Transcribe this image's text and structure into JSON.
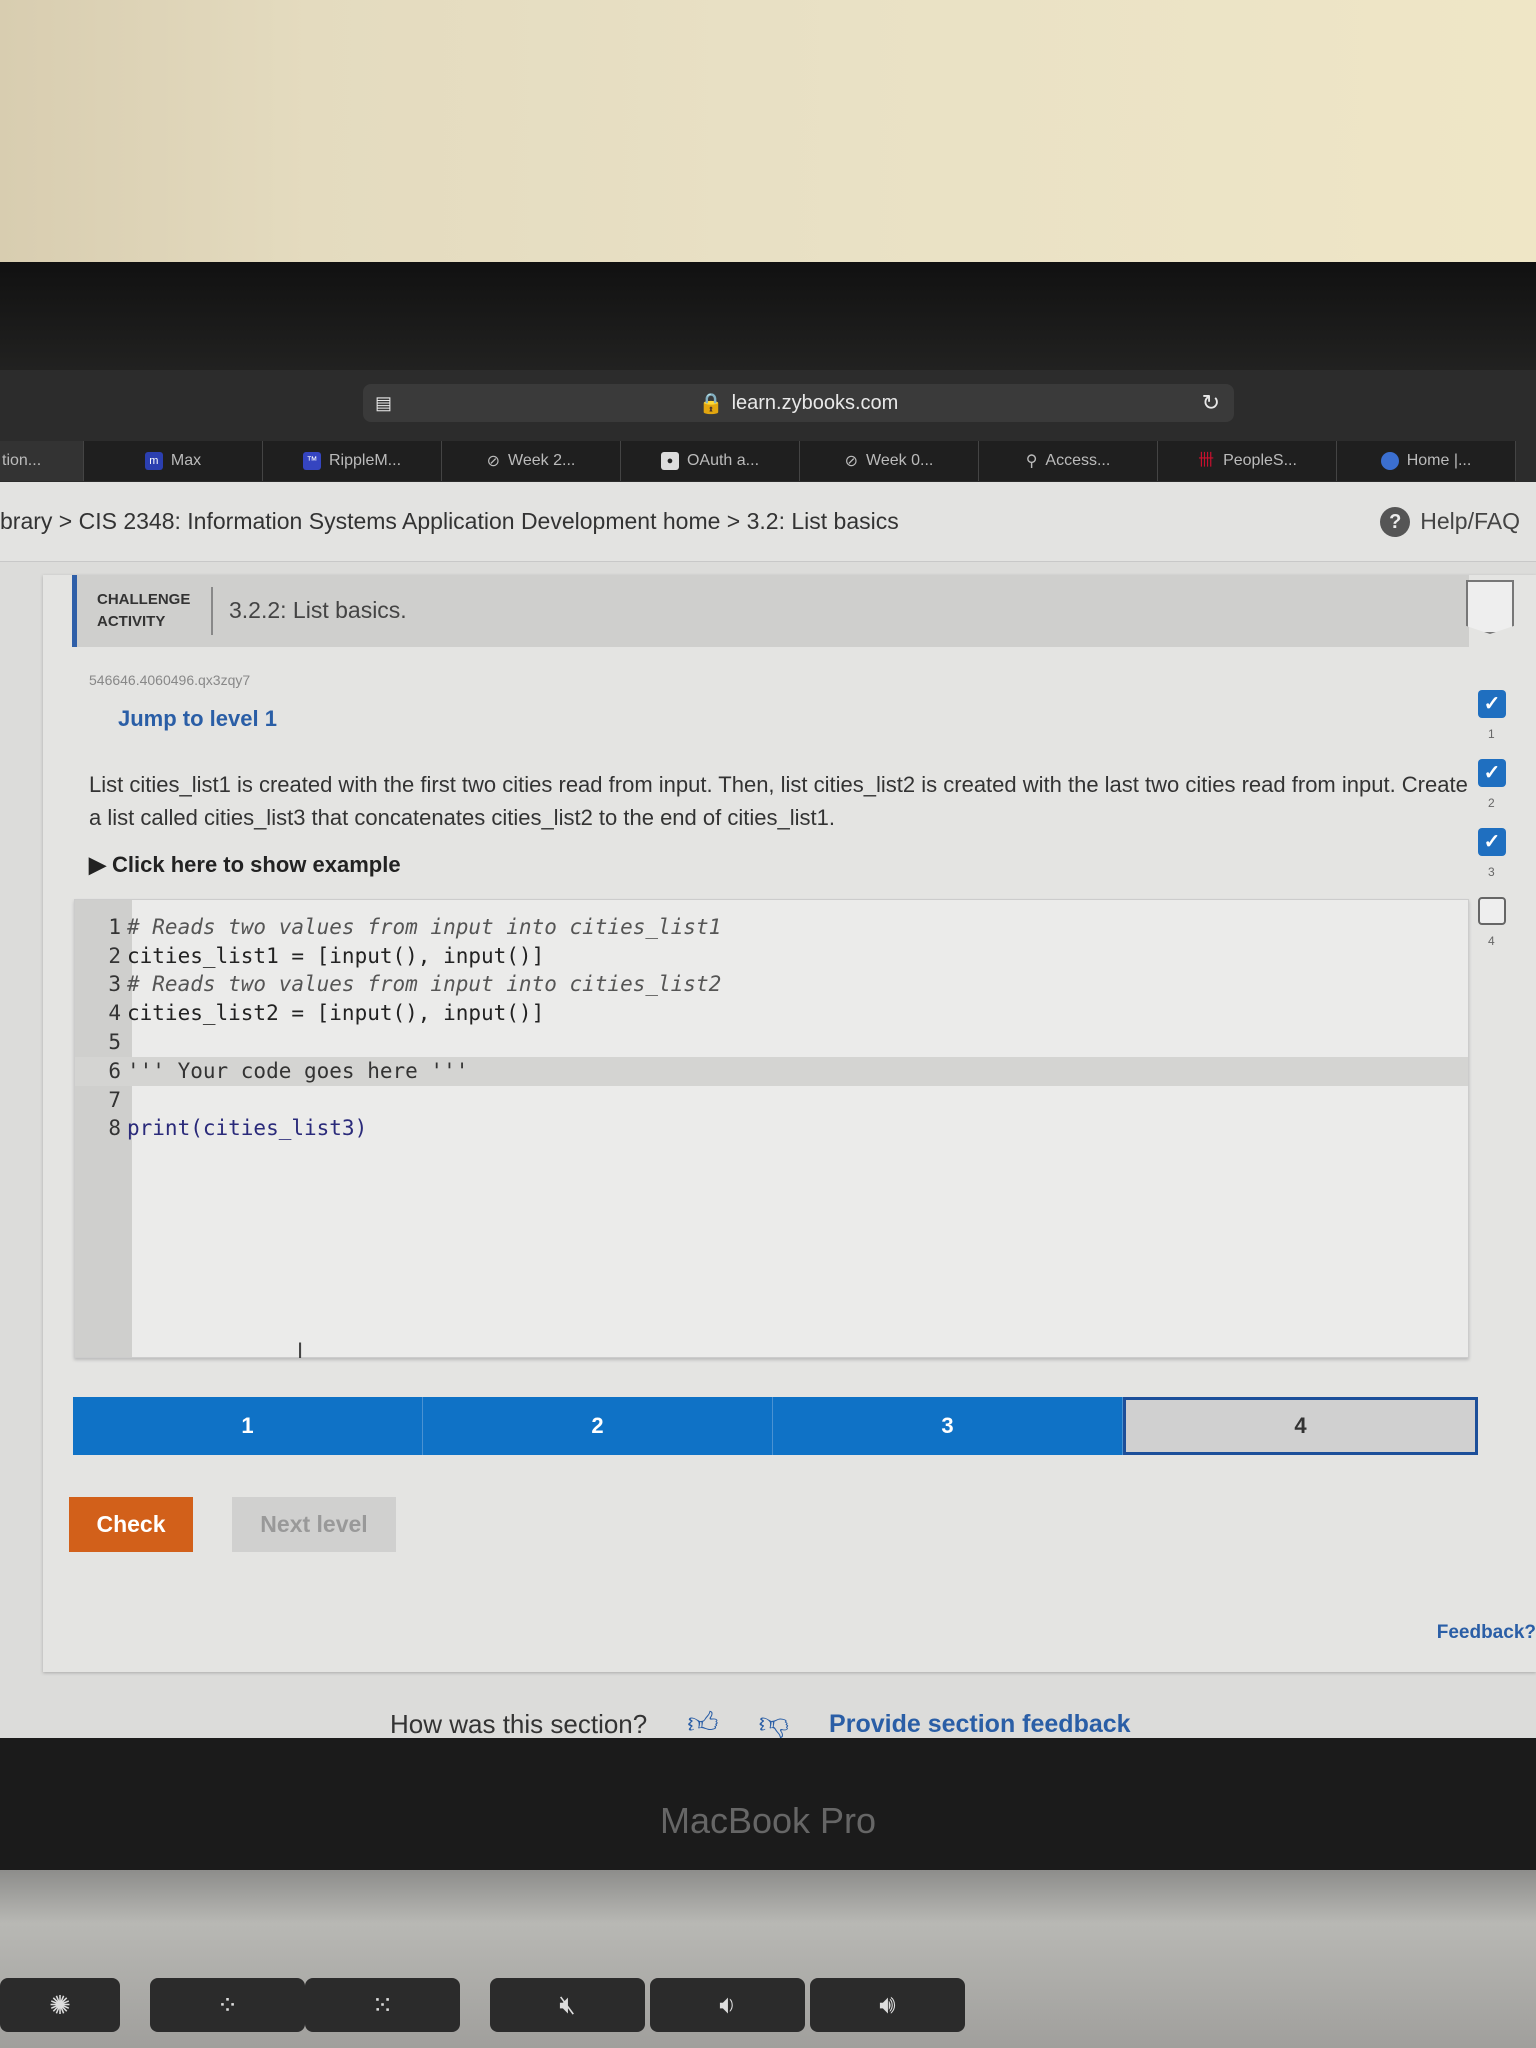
{
  "browser": {
    "url": "learn.zybooks.com",
    "tabs": [
      {
        "label": "tion...",
        "icon": "none"
      },
      {
        "label": "Max",
        "icon": "m-logo-icon",
        "color": "#2b3fb0"
      },
      {
        "label": "RippleM...",
        "icon": "ripplematch-icon",
        "color": "#3545c0"
      },
      {
        "label": "Week 2...",
        "icon": "compass-icon"
      },
      {
        "label": "OAuth a...",
        "icon": "github-icon"
      },
      {
        "label": "Week 0...",
        "icon": "compass-icon"
      },
      {
        "label": "Access...",
        "icon": "access-icon"
      },
      {
        "label": "PeopleS...",
        "icon": "uh-logo-icon",
        "color": "#c8102e"
      },
      {
        "label": "Home |...",
        "icon": "home-app-icon"
      }
    ]
  },
  "breadcrumb": "brary > CIS 2348: Information Systems Application Development home > 3.2: List basics",
  "help": {
    "label": "Help/FAQ"
  },
  "activity": {
    "type_line1": "CHALLENGE",
    "type_line2": "ACTIVITY",
    "title": "3.2.2: List basics.",
    "id": "546646.4060496.qx3zqy7",
    "jump": "Jump to level 1",
    "prompt": "List cities_list1 is created with the first two cities read from input. Then, list cities_list2 is created with the last two cities read from input. Create a list called cities_list3 that concatenates cities_list2 to the end of cities_list1.",
    "example": "▶ Click here to show example"
  },
  "code": [
    {
      "n": "1",
      "text": "# Reads two values from input into cities_list1",
      "kind": "comment"
    },
    {
      "n": "2",
      "text": "cities_list1 = [input(), input()]",
      "kind": "code"
    },
    {
      "n": "3",
      "text": "# Reads two values from input into cities_list2",
      "kind": "comment"
    },
    {
      "n": "4",
      "text": "cities_list2 = [input(), input()]",
      "kind": "code"
    },
    {
      "n": "5",
      "text": "",
      "kind": "code"
    },
    {
      "n": "6",
      "text": "''' Your code goes here '''",
      "kind": "string"
    },
    {
      "n": "7",
      "text": "",
      "kind": "code"
    },
    {
      "n": "8",
      "text": "print(cities_list3)",
      "kind": "code"
    }
  ],
  "levels": {
    "items": [
      "1",
      "2",
      "3",
      "4"
    ],
    "current": "4",
    "completed": [
      "1",
      "2",
      "3"
    ]
  },
  "buttons": {
    "check": "Check",
    "next": "Next level"
  },
  "feedback": "Feedback?",
  "section": {
    "question": "How was this section?",
    "link": "Provide section feedback"
  },
  "laptop": {
    "model": "MacBook Pro"
  },
  "colors": {
    "accent": "#0f72c6",
    "check": "#d2601a",
    "link": "#2a5ea6"
  }
}
